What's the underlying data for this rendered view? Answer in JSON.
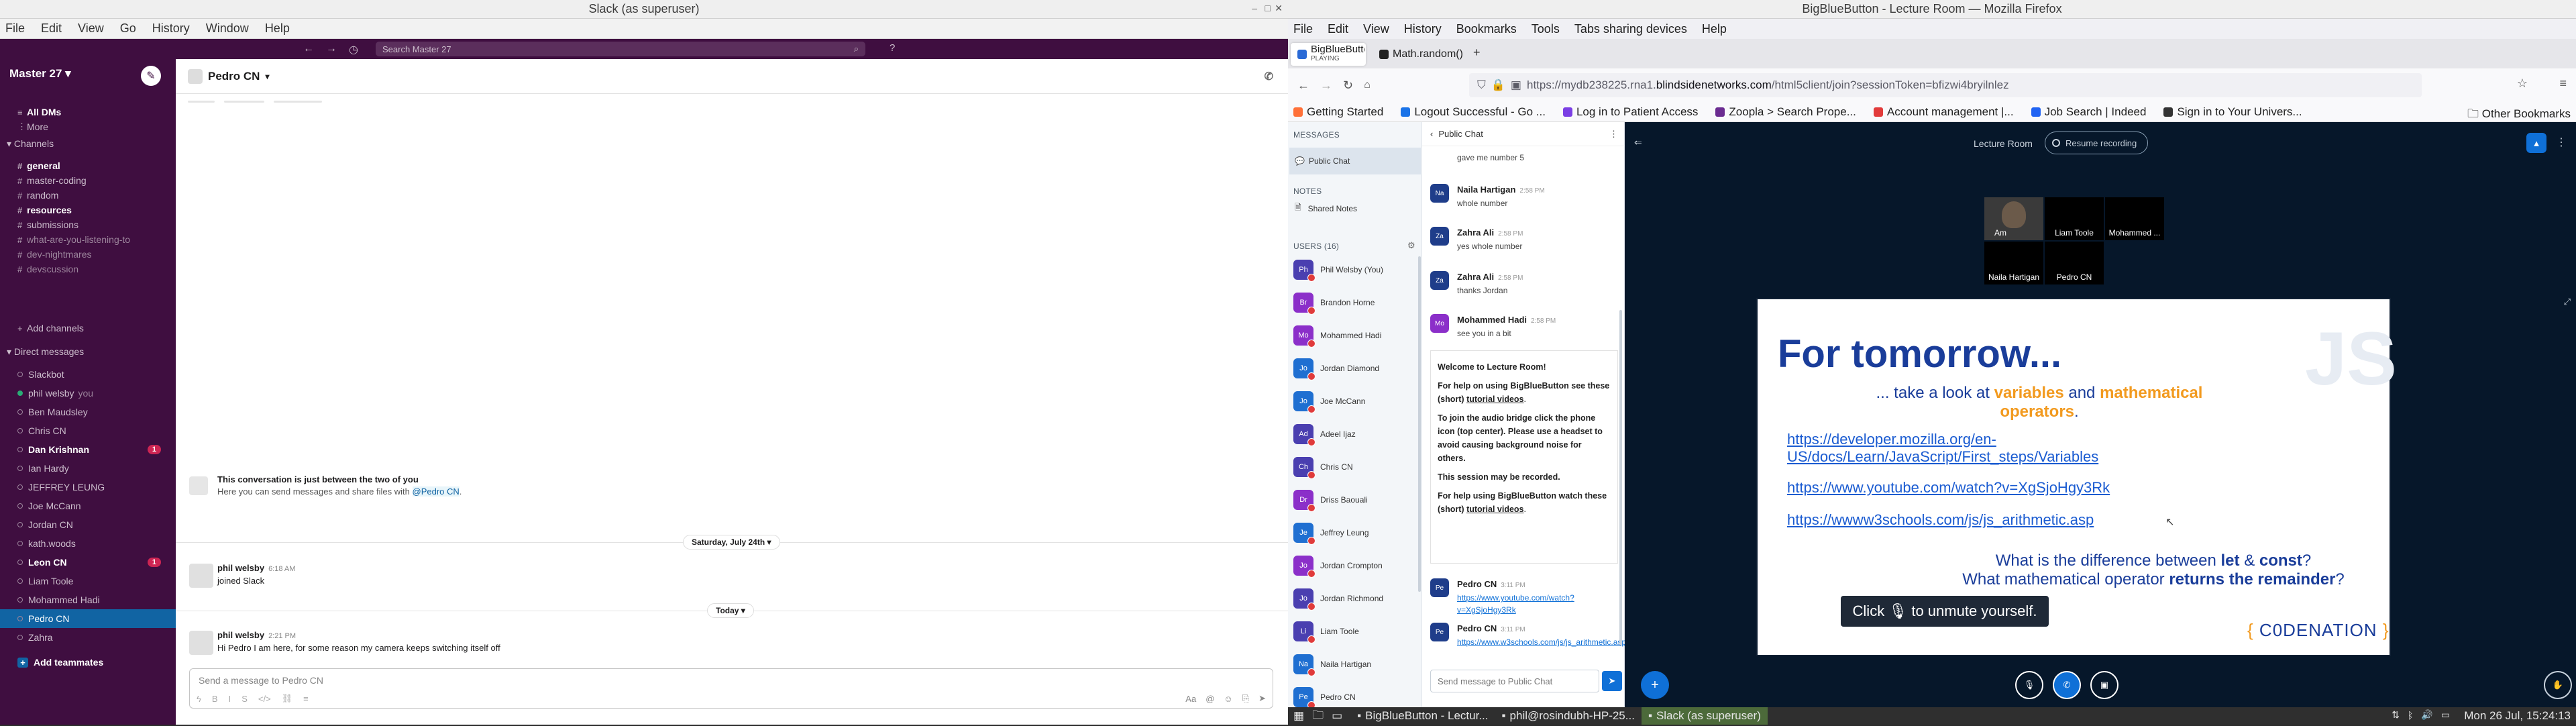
{
  "slack": {
    "window_title": "Slack (as superuser)",
    "menu": [
      "File",
      "Edit",
      "View",
      "Go",
      "History",
      "Window",
      "Help"
    ],
    "search_placeholder": "Search Master 27",
    "workspace": "Master 27",
    "nav": {
      "all_dms": "All DMs",
      "more": "More"
    },
    "channels_header": "Channels",
    "channels": [
      {
        "name": "general",
        "style": "bold"
      },
      {
        "name": "master-coding",
        "style": "normal"
      },
      {
        "name": "random",
        "style": "normal"
      },
      {
        "name": "resources",
        "style": "bold"
      },
      {
        "name": "submissions",
        "style": "normal"
      },
      {
        "name": "what-are-you-listening-to",
        "style": "muted"
      },
      {
        "name": "dev-nightmares",
        "style": "muted"
      },
      {
        "name": "devscussion",
        "style": "muted"
      }
    ],
    "add_channels": "Add channels",
    "dm_header": "Direct messages",
    "dms": [
      {
        "name": "Slackbot",
        "style": "normal",
        "online": false,
        "badge": ""
      },
      {
        "name": "phil welsby",
        "suffix": "you",
        "style": "normal",
        "online": true,
        "badge": ""
      },
      {
        "name": "Ben Maudsley",
        "style": "normal",
        "online": false,
        "badge": ""
      },
      {
        "name": "Chris CN",
        "style": "normal",
        "online": false,
        "badge": ""
      },
      {
        "name": "Dan Krishnan",
        "style": "bold",
        "online": false,
        "badge": "1"
      },
      {
        "name": "Ian Hardy",
        "style": "normal",
        "online": false,
        "badge": ""
      },
      {
        "name": "JEFFREY LEUNG",
        "style": "normal",
        "online": false,
        "badge": ""
      },
      {
        "name": "Joe McCann",
        "style": "normal",
        "online": false,
        "badge": ""
      },
      {
        "name": "Jordan CN",
        "style": "normal",
        "online": false,
        "badge": ""
      },
      {
        "name": "kath.woods",
        "style": "normal",
        "online": false,
        "badge": ""
      },
      {
        "name": "Leon CN",
        "style": "bold",
        "online": false,
        "badge": "1"
      },
      {
        "name": "Liam Toole",
        "style": "normal",
        "online": false,
        "badge": ""
      },
      {
        "name": "Mohammed Hadi",
        "style": "normal",
        "online": false,
        "badge": ""
      },
      {
        "name": "Pedro CN",
        "style": "selected",
        "online": false,
        "badge": ""
      },
      {
        "name": "Zahra",
        "style": "normal",
        "online": false,
        "badge": ""
      }
    ],
    "add_teammates": "Add teammates",
    "conversation": {
      "title": "Pedro CN",
      "intro_title": "This conversation is just between the two of you",
      "intro_text": "Here you can send messages and share files with",
      "intro_mention": "@Pedro CN",
      "day1": "Saturday, July 24th",
      "day2": "Today",
      "messages": [
        {
          "author": "phil welsby",
          "time": "6:18 AM",
          "text": "joined Slack"
        },
        {
          "author": "phil welsby",
          "time": "2:21 PM",
          "text": "Hi Pedro I am here, for some reason my camera keeps switching itself off"
        }
      ],
      "composer_placeholder": "Send a message to Pedro CN"
    }
  },
  "firefox": {
    "window_title": "BigBlueButton - Lecture Room — Mozilla Firefox",
    "menu": [
      "File",
      "Edit",
      "View",
      "History",
      "Bookmarks",
      "Tools",
      "Tabs sharing devices",
      "Help"
    ],
    "tabs": [
      {
        "title": "BigBlueButton - Lec",
        "sub": "PLAYING",
        "active": true
      },
      {
        "title": "Math.random() - Jav",
        "sub": "",
        "active": false
      }
    ],
    "url_prefix": "https://mydb238225.rna1.",
    "url_domain": "blindsidenetworks.com",
    "url_suffix": "/html5client/join?sessionToken=bfizwi4bryilnlez",
    "bookmarks": [
      {
        "label": "Getting Started",
        "color": "#ff7139"
      },
      {
        "label": "Logout Successful - Go ...",
        "color": "#1a73e8"
      },
      {
        "label": "Log in to Patient Access",
        "color": "#7b3fe4"
      },
      {
        "label": "Zoopla > Search Prope...",
        "color": "#6b2c91"
      },
      {
        "label": "Account management |...",
        "color": "#e23b3b"
      },
      {
        "label": "Job Search | Indeed",
        "color": "#2164f3"
      },
      {
        "label": "Sign in to Your Univers...",
        "color": "#333333"
      }
    ],
    "other_bookmarks": "Other Bookmarks"
  },
  "bbb": {
    "messages_label": "MESSAGES",
    "public_chat": "Public Chat",
    "notes_label": "NOTES",
    "shared_notes": "Shared Notes",
    "users_label": "USERS (16)",
    "users": [
      {
        "name": "Phil Welsby (You)",
        "initials": "Ph",
        "color": "#4a3fb0"
      },
      {
        "name": "Brandon Horne",
        "initials": "Br",
        "color": "#8b2fc9"
      },
      {
        "name": "Mohammed Hadi",
        "initials": "Mo",
        "color": "#8b2fc9"
      },
      {
        "name": "Jordan Diamond",
        "initials": "Jo",
        "color": "#1f6fd1"
      },
      {
        "name": "Joe McCann",
        "initials": "Jo",
        "color": "#1f6fd1"
      },
      {
        "name": "Adeel Ijaz",
        "initials": "Ad",
        "color": "#4a3fb0"
      },
      {
        "name": "Chris CN",
        "initials": "Ch",
        "color": "#4a3fb0"
      },
      {
        "name": "Driss Baouali",
        "initials": "Dr",
        "color": "#8b2fc9"
      },
      {
        "name": "Jeffrey Leung",
        "initials": "Je",
        "color": "#1f6fd1"
      },
      {
        "name": "Jordan Crompton",
        "initials": "Jo",
        "color": "#8b2fc9"
      },
      {
        "name": "Jordan Richmond",
        "initials": "Jo",
        "color": "#4a3fb0"
      },
      {
        "name": "Liam Toole",
        "initials": "Li",
        "color": "#4a3fb0"
      },
      {
        "name": "Naila Hartigan",
        "initials": "Na",
        "color": "#1f6fd1"
      },
      {
        "name": "Pedro CN",
        "initials": "Pe",
        "color": "#1f6fd1"
      }
    ],
    "chat_header": "Public Chat",
    "chat_messages": [
      {
        "author": "",
        "initials": "",
        "time": "",
        "text": "gave me number 5",
        "color": "#4a3fb0"
      },
      {
        "author": "Naila Hartigan",
        "initials": "Na",
        "time": "2:58 PM",
        "text": "whole number",
        "color": "#1f3d8a"
      },
      {
        "author": "Zahra Ali",
        "initials": "Za",
        "time": "2:58 PM",
        "text": "yes whole number",
        "color": "#1f3d8a"
      },
      {
        "author": "Zahra Ali",
        "initials": "Za",
        "time": "2:58 PM",
        "text": "thanks Jordan",
        "color": "#1f3d8a"
      },
      {
        "author": "Mohammed Hadi",
        "initials": "Mo",
        "time": "2:58 PM",
        "text": "see you in a bit",
        "color": "#8b2fc9"
      }
    ],
    "welcome": {
      "l1_a": "Welcome to ",
      "l1_b": "Lecture Room!",
      "l2": "For help on using BigBlueButton see these (short)",
      "l2_link": "tutorial videos",
      "l3": "To join the audio bridge click the phone icon (top center). Please use a headset to avoid causing background noise for others.",
      "l4": "This session may be recorded.",
      "l5": "For help using BigBlueButton watch these (short)",
      "l5_link": "tutorial videos"
    },
    "pedro_messages": [
      {
        "author": "Pedro CN",
        "initials": "Pe",
        "time": "3:11 PM",
        "link": "https://www.youtube.com/watch?v=XgSjoHgy3Rk"
      },
      {
        "author": "Pedro CN",
        "initials": "Pe",
        "time": "3:11 PM",
        "link": "https://www.w3schools.com/js/js_arithmetic.asp"
      }
    ],
    "chat_placeholder": "Send message to Public Chat",
    "lecture_title": "Lecture Room",
    "resume_recording": "Resume recording",
    "videos": [
      {
        "name": "Am",
        "kind": "camera"
      },
      {
        "name": "Liam Toole",
        "kind": "off"
      },
      {
        "name": "Mohammed ...",
        "kind": "off"
      },
      {
        "name": "Naila Hartigan",
        "kind": "off"
      },
      {
        "name": "Pedro CN",
        "kind": "off"
      }
    ],
    "slide": {
      "title": "For tomorrow...",
      "corner": "JS",
      "sub_a": "... take a look at ",
      "sub_b": "variables",
      "sub_c": " and ",
      "sub_d": "mathematical operators",
      "sub_e": ".",
      "link1": "https://developer.mozilla.org/en-US/docs/Learn/JavaScript/First_steps/Variables",
      "link2": "https://www.youtube.com/watch?v=XgSjoHgy3Rk",
      "link3": "https://wwww3schools.com/js/js_arithmetic.asp",
      "q1_a": "What is the difference between ",
      "q1_b": "let",
      "q1_c": " & ",
      "q1_d": "const",
      "q1_e": "?",
      "q2_a": "What mathematical operator ",
      "q2_b": "returns the remainder",
      "q2_c": "?",
      "brand_l": "{",
      "brand": "C0DENATION",
      "brand_r": "}"
    },
    "unmute_tip": "Click 🎙 to unmute yourself."
  },
  "taskbar": {
    "items": [
      {
        "label": "BigBlueButton - Lectur...",
        "active": false
      },
      {
        "label": "phil@rosindubh-HP-25...",
        "active": false
      },
      {
        "label": "Slack (as superuser)",
        "active": true
      }
    ],
    "clock": "Mon 26 Jul, 15:24:13"
  },
  "colors": {
    "slack_aubergine": "#3f0e40",
    "slack_selected": "#1164a3",
    "bbb_dark": "#06172a",
    "bbb_blue": "#0f70d7",
    "slide_navy": "#1a3d9a",
    "slide_orange": "#f29a1f"
  }
}
